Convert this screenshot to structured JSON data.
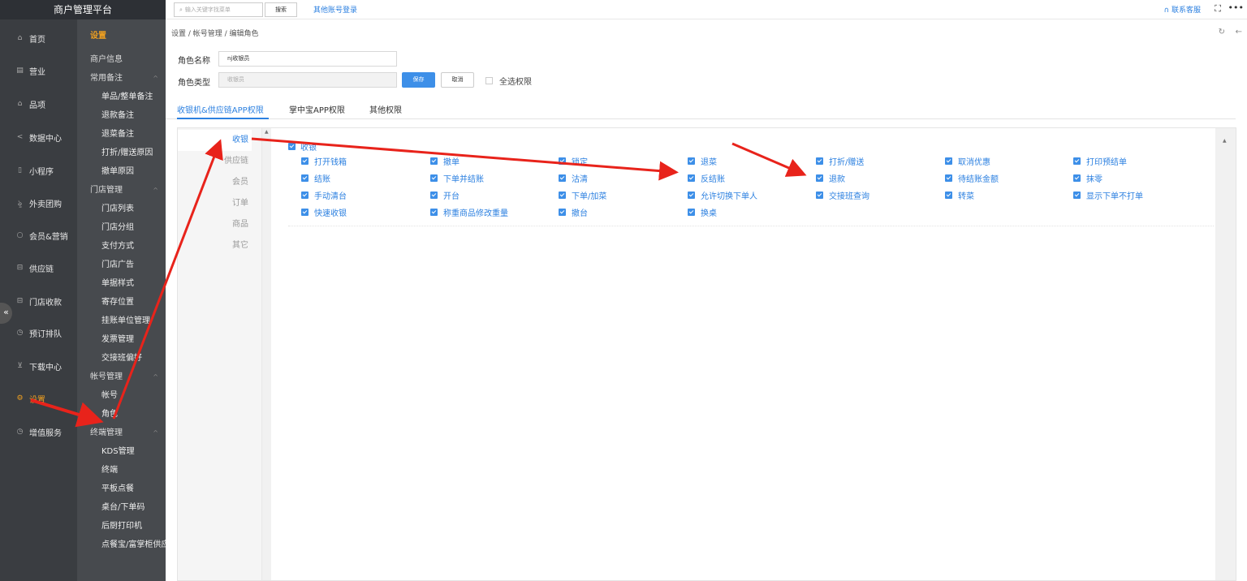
{
  "brand": "商户管理平台",
  "topbar": {
    "search_placeholder": "输入关键字找菜单",
    "search_button": "搜索",
    "other_login": "其他账号登录",
    "service": "联系客服"
  },
  "nav1": [
    {
      "label": "首页",
      "icon": "home-icon"
    },
    {
      "label": "营业",
      "icon": "calendar-icon"
    },
    {
      "label": "品项",
      "icon": "bag-icon"
    },
    {
      "label": "数据中心",
      "icon": "share-icon"
    },
    {
      "label": "小程序",
      "icon": "phone-icon"
    },
    {
      "label": "外卖团购",
      "icon": "delivery-icon"
    },
    {
      "label": "会员&营销",
      "icon": "user-icon"
    },
    {
      "label": "供应链",
      "icon": "truck-icon"
    },
    {
      "label": "门店收款",
      "icon": "wallet-icon"
    },
    {
      "label": "预订排队",
      "icon": "clock-icon"
    },
    {
      "label": "下载中心",
      "icon": "download-icon"
    },
    {
      "label": "设置",
      "icon": "gear-icon",
      "active": true
    },
    {
      "label": "增值服务",
      "icon": "alarm-icon"
    }
  ],
  "nav2": {
    "header": "设置",
    "items": [
      {
        "label": "商户信息",
        "type": "grp"
      },
      {
        "label": "常用备注",
        "type": "grp",
        "expandable": true
      },
      {
        "label": "单品/整单备注",
        "type": "sub"
      },
      {
        "label": "退款备注",
        "type": "sub"
      },
      {
        "label": "退菜备注",
        "type": "sub"
      },
      {
        "label": "打折/赠送原因",
        "type": "sub"
      },
      {
        "label": "撤单原因",
        "type": "sub"
      },
      {
        "label": "门店管理",
        "type": "grp",
        "expandable": true
      },
      {
        "label": "门店列表",
        "type": "sub"
      },
      {
        "label": "门店分组",
        "type": "sub"
      },
      {
        "label": "支付方式",
        "type": "sub"
      },
      {
        "label": "门店广告",
        "type": "sub"
      },
      {
        "label": "单据样式",
        "type": "sub"
      },
      {
        "label": "寄存位置",
        "type": "sub"
      },
      {
        "label": "挂账单位管理",
        "type": "sub"
      },
      {
        "label": "发票管理",
        "type": "sub"
      },
      {
        "label": "交接班偏好",
        "type": "sub"
      },
      {
        "label": "帐号管理",
        "type": "grp",
        "expandable": true
      },
      {
        "label": "帐号",
        "type": "sub"
      },
      {
        "label": "角色",
        "type": "sub"
      },
      {
        "label": "终端管理",
        "type": "grp",
        "expandable": true
      },
      {
        "label": "KDS管理",
        "type": "sub"
      },
      {
        "label": "终端",
        "type": "sub"
      },
      {
        "label": "平板点餐",
        "type": "sub"
      },
      {
        "label": "桌台/下单码",
        "type": "sub"
      },
      {
        "label": "后厨打印机",
        "type": "sub"
      },
      {
        "label": "点餐宝/富掌柜供应",
        "type": "sub"
      }
    ]
  },
  "breadcrumb": "设置 / 帐号管理 / 编辑角色",
  "form": {
    "role_name_label": "角色名称",
    "role_name_value": "nj收银员",
    "role_type_label": "角色类型",
    "role_type_value": "收银员",
    "save": "保存",
    "cancel": "取消",
    "select_all": "全选权限"
  },
  "tabs": [
    {
      "label": "收银机&供应链APP权限",
      "active": true
    },
    {
      "label": "掌中宝APP权限"
    },
    {
      "label": "其他权限"
    }
  ],
  "perm_nav": [
    {
      "label": "收银",
      "active": true
    },
    {
      "label": "供应链"
    },
    {
      "label": "会员"
    },
    {
      "label": "订单"
    },
    {
      "label": "商品"
    },
    {
      "label": "其它"
    }
  ],
  "perm_group": "收银",
  "permissions": [
    [
      "打开钱箱",
      "撤单",
      "锁定",
      "退菜",
      "打折/赠送",
      "取消优惠",
      "打印预结单"
    ],
    [
      "结账",
      "下单并结账",
      "沽清",
      "反结账",
      "退款",
      "待结账金额",
      "抹零"
    ],
    [
      "手动清台",
      "开台",
      "下单/加菜",
      "允许切换下单人",
      "交接班查询",
      "转菜",
      "显示下单不打单"
    ],
    [
      "快速收银",
      "称重商品修改重量",
      "撤台",
      "换桌"
    ]
  ],
  "colors": {
    "accent": "#2c80e0",
    "active_nav": "#f0a020",
    "annotation_arrow": "#e8231b"
  }
}
